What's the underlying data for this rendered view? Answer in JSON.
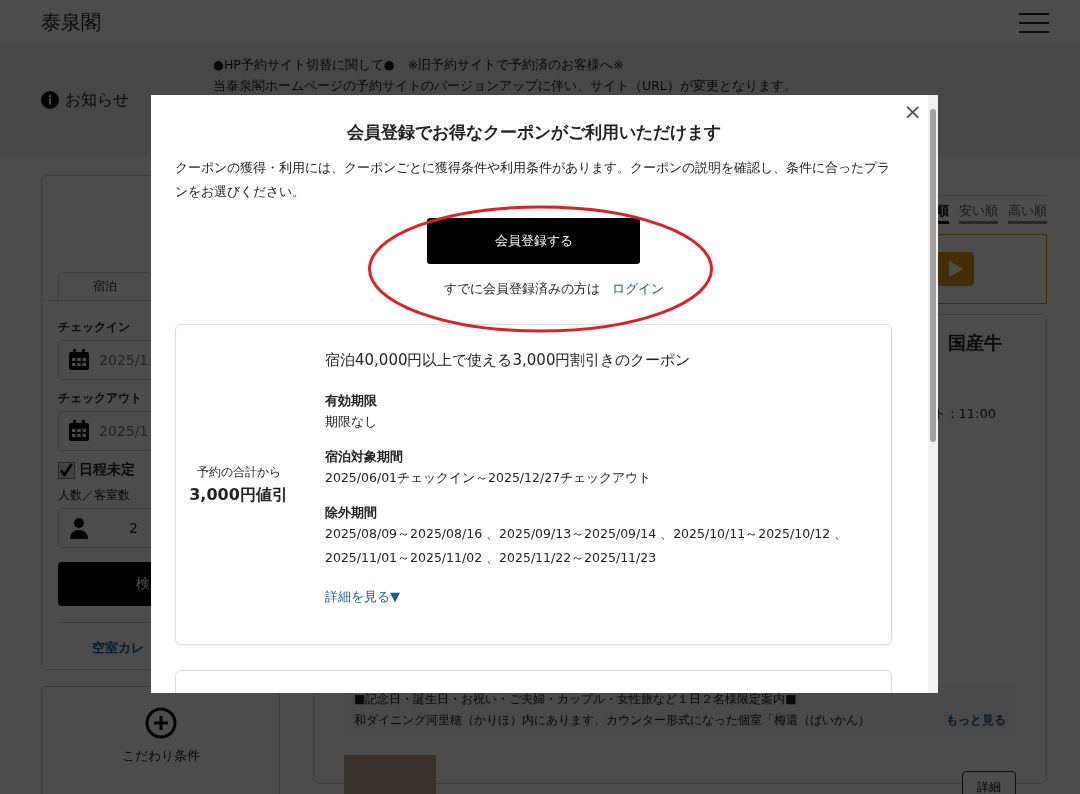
{
  "header": {
    "logo": "泰泉閣"
  },
  "notice": {
    "label": "お知らせ",
    "lines": [
      "●HP予約サイト切替に関して●　※旧予約サイトで予約済のお客様へ※",
      "当泰泉閣ホームページの予約サイトのバージョンアップに伴い、サイト（URL）が変更となります。"
    ]
  },
  "search_panel": {
    "tabs": [
      {
        "label": "宿泊",
        "selected": true
      }
    ],
    "fields": [
      {
        "label": "チェックイン",
        "value": "2025/1"
      },
      {
        "label": "チェックアウト",
        "value": "2025/1"
      }
    ],
    "undecided": {
      "label": "日程未定",
      "checked": true
    },
    "guests": {
      "label": "人数／客室数",
      "value": "2"
    },
    "search_button": "検",
    "calendar_link": "空室カレ"
  },
  "filter_panel": {
    "label": "こだわり条件"
  },
  "sort_tabs": [
    {
      "label": "順",
      "selected": true
    },
    {
      "label": "安い順",
      "selected": false
    },
    {
      "label": "高い順",
      "selected": false
    }
  ],
  "plan": {
    "title": "国産牛",
    "checkout": "ト：11:00",
    "notes": [
      "■記念日・誕生日・お祝い・ご夫婦・カップル・女性旅など１日２名様限定案内■",
      "和ダイニング河里穂（かりほ）内にあります、カウンター形式になった個室「梅還（ばいかん）"
    ],
    "more_link": "もっと見る",
    "detail_button": "詳細"
  },
  "modal": {
    "close": "×",
    "title": "会員登録でお得なクーポンがご利用いただけます",
    "description": "クーポンの獲得・利用には、クーポンごとに獲得条件や利用条件があります。クーポンの説明を確認し、条件に合ったプランをお選びください。",
    "register_button": "会員登録する",
    "login_prompt": "すでに会員登録済みの方は",
    "login_link": "ログイン",
    "coupons": [
      {
        "discount_label": "予約の合計から",
        "discount": "3,000円値引",
        "title": "宿泊40,000円以上で使える3,000円割引きのクーポン",
        "sections": [
          {
            "heading": "有効期限",
            "body": "期限なし"
          },
          {
            "heading": "宿泊対象期間",
            "body": "2025/06/01チェックイン～2025/12/27チェックアウト"
          },
          {
            "heading": "除外期間",
            "body": "2025/08/09～2025/08/16 、2025/09/13～2025/09/14 、2025/10/11～2025/10/12 、2025/11/01～2025/11/02 、2025/11/22～2025/11/23"
          }
        ],
        "details_link": "詳細を見る▼"
      }
    ]
  }
}
